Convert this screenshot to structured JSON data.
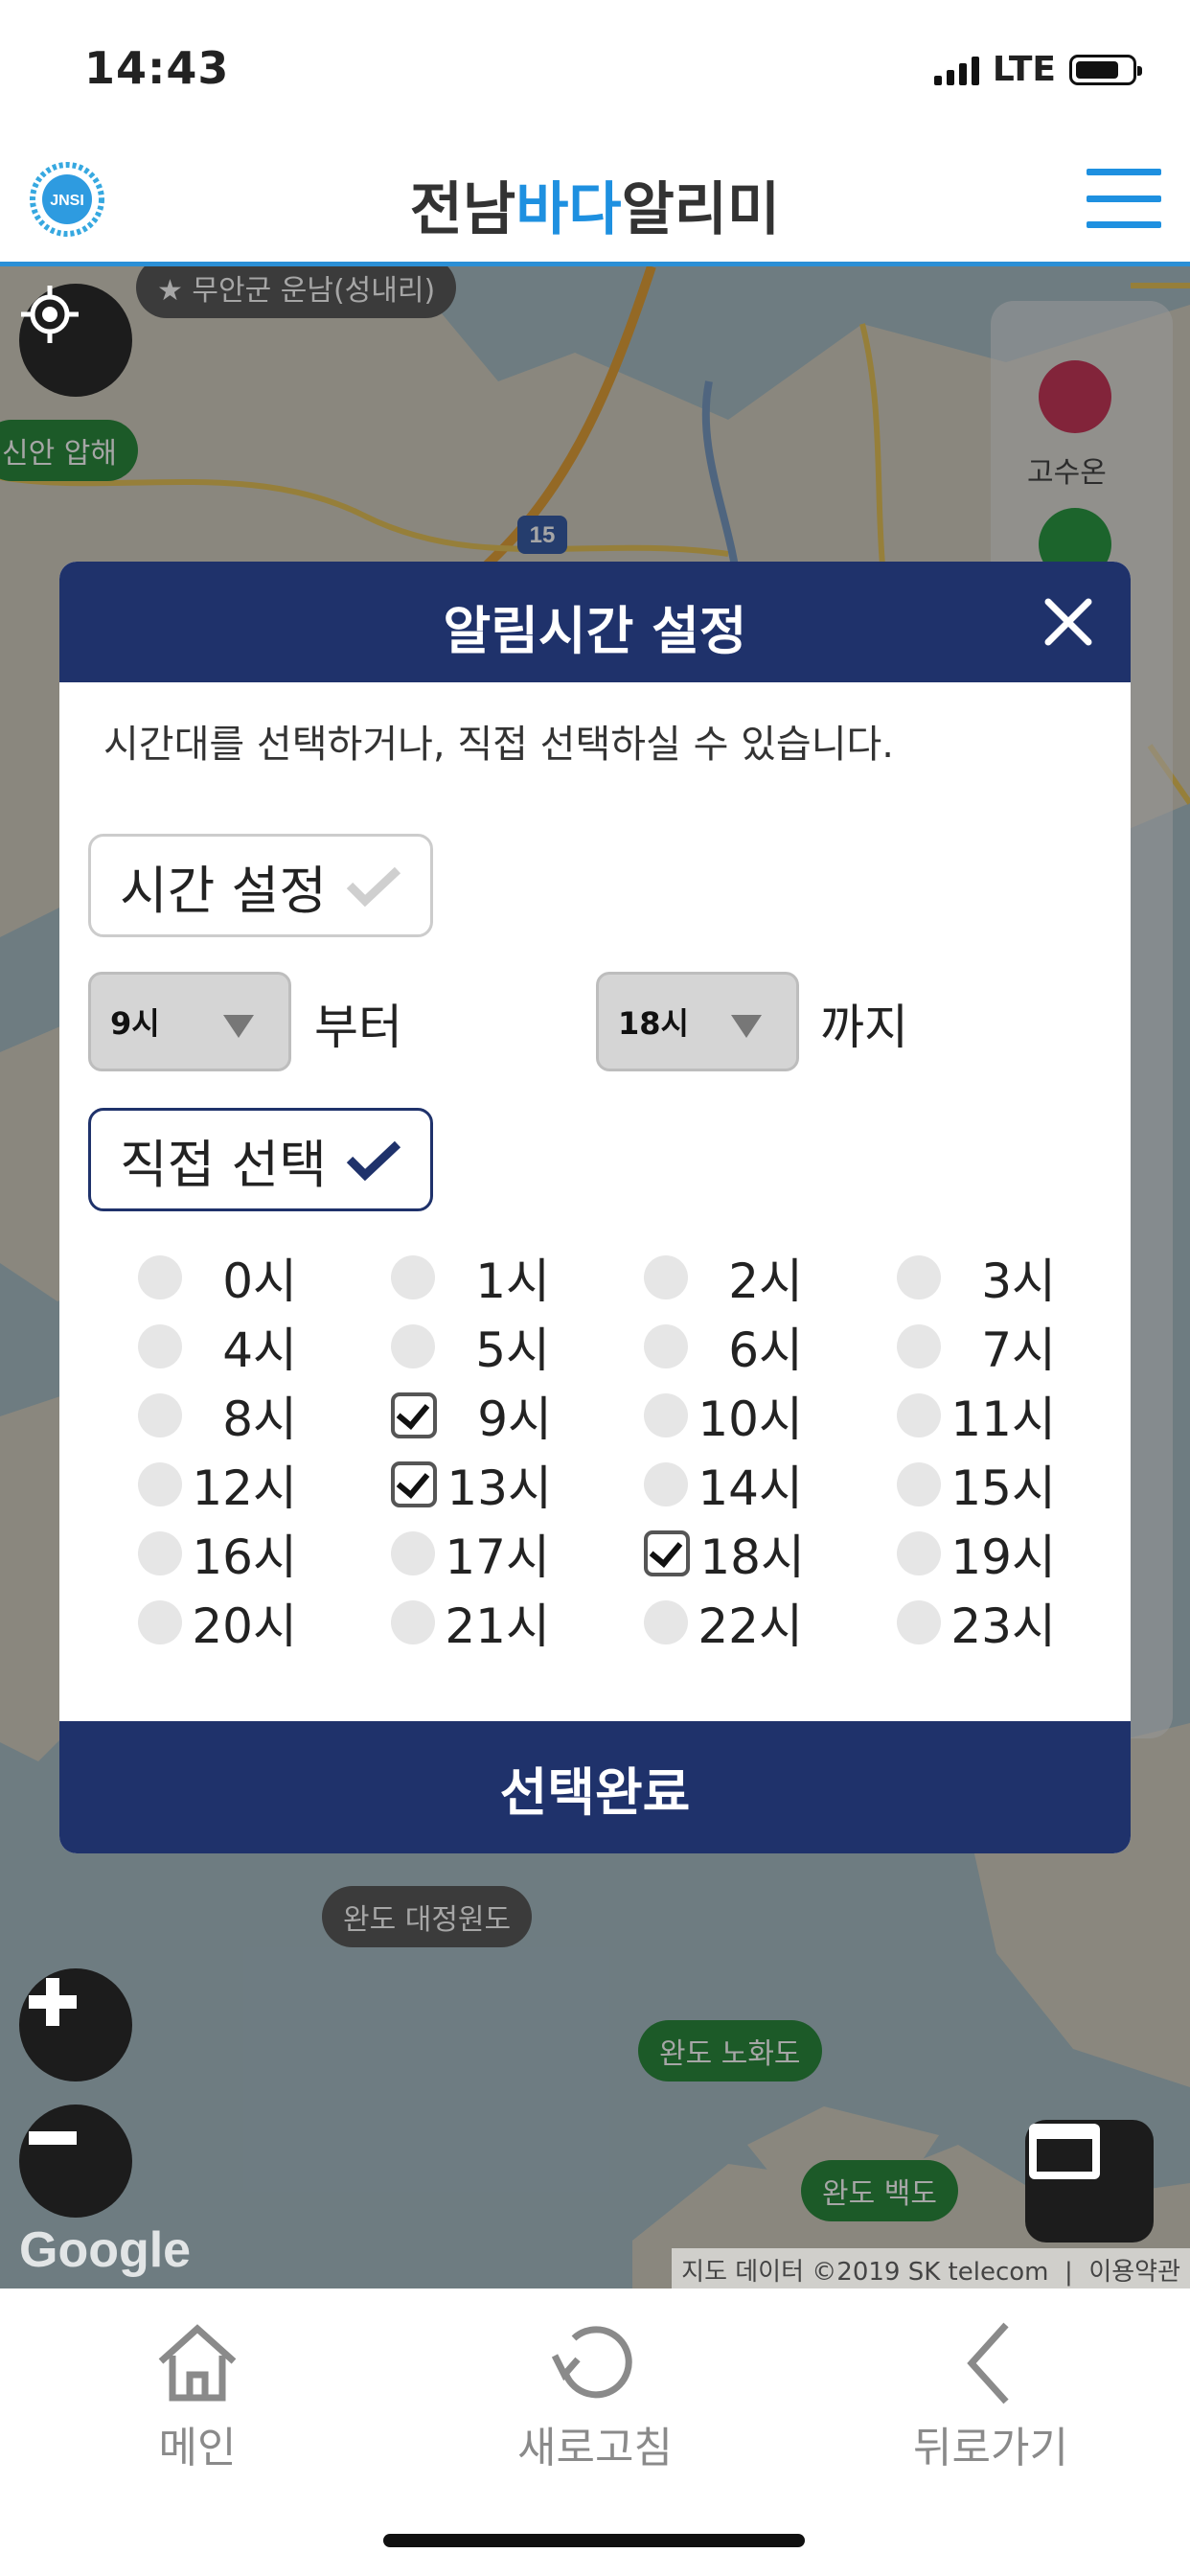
{
  "status_bar": {
    "time": "14:43",
    "network": "LTE"
  },
  "header": {
    "logo_text": "JNSI",
    "title_part1": "전남",
    "title_part2": "바다",
    "title_part3": "알리미"
  },
  "map": {
    "markers": {
      "m1": "★ 무안군 운남(성내리)",
      "m2": "신안 압해",
      "m3": "완도 대정원도",
      "m4": "완도 노화도",
      "m5": "완도 백도",
      "m6": "고수온"
    },
    "road_number": "15",
    "google": "Google",
    "attribution": "지도 데이터 ©2019 SK telecom",
    "terms": "이용약관"
  },
  "modal": {
    "title": "알림시간 설정",
    "description": "시간대를 선택하거나, 직접 선택하실 수 있습니다.",
    "time_setting_label": "시간 설정",
    "from_value": "9시",
    "from_suffix": "부터",
    "to_value": "18시",
    "to_suffix": "까지",
    "direct_label": "직접 선택",
    "hours": [
      "0시",
      "1시",
      "2시",
      "3시",
      "4시",
      "5시",
      "6시",
      "7시",
      "8시",
      "9시",
      "10시",
      "11시",
      "12시",
      "13시",
      "14시",
      "15시",
      "16시",
      "17시",
      "18시",
      "19시",
      "20시",
      "21시",
      "22시",
      "23시"
    ],
    "checked_hours": [
      9,
      13,
      18
    ],
    "done_label": "선택완료"
  },
  "bottom_nav": {
    "main": "메인",
    "refresh": "새로고침",
    "back": "뒤로가기"
  }
}
